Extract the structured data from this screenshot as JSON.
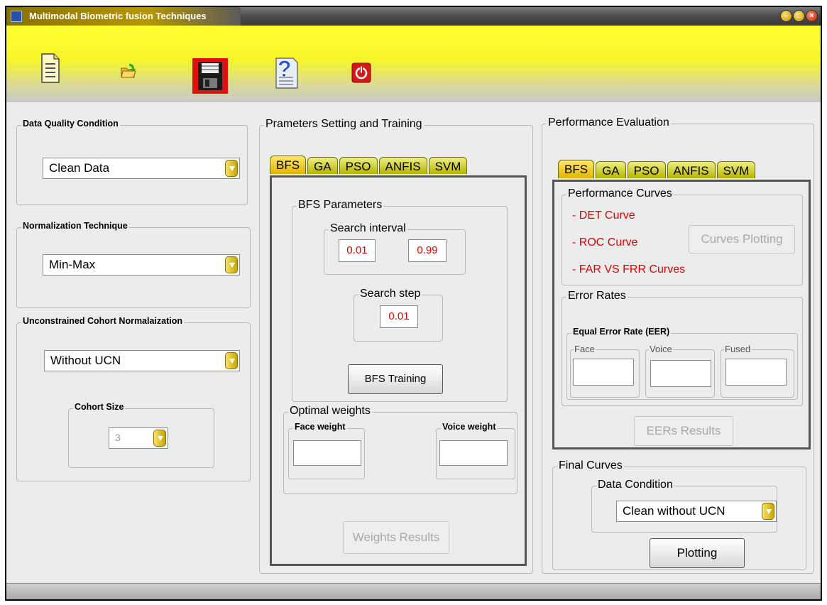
{
  "window": {
    "title": "Multimodal Biometric fusion Techniques"
  },
  "toolbar": {
    "icons": [
      "new-document-icon",
      "open-folder-icon",
      "save-floppy-icon",
      "help-icon",
      "power-exit-icon"
    ]
  },
  "left": {
    "data_quality": {
      "label": "Data Quality Condition",
      "value": "Clean Data"
    },
    "normalization": {
      "label": "Normalization Technique",
      "value": "Min-Max"
    },
    "ucn": {
      "label": "Unconstrained Cohort  Normalaization",
      "value": "Without UCN"
    },
    "cohort": {
      "label": "Cohort Size",
      "value": "3"
    }
  },
  "params": {
    "title": "Prameters Setting and Training",
    "tabs": [
      "BFS",
      "GA",
      "PSO",
      "ANFIS",
      "SVM"
    ],
    "bfs_parameters": "BFS Parameters",
    "search_interval": {
      "label": "Search interval",
      "min": "0.01",
      "max": "0.99"
    },
    "search_step": {
      "label": "Search step",
      "value": "0.01"
    },
    "train_button": "BFS Training",
    "optimal_weights": "Optimal weights",
    "face_weight": "Face weight",
    "voice_weight": "Voice weight",
    "weights_button": "Weights Results"
  },
  "perf": {
    "title": "Performance Evaluation",
    "tabs": [
      "BFS",
      "GA",
      "PSO",
      "ANFIS",
      "SVM"
    ],
    "curves_label": "Performance Curves",
    "curves": [
      "- DET Curve",
      "- ROC Curve",
      "- FAR VS FRR Curves"
    ],
    "curves_button": "Curves Plotting",
    "error_rates": "Error Rates",
    "eer_label": "Equal Error Rate (EER)",
    "eer_face": "Face",
    "eer_voice": "Voice",
    "eer_fused": "Fused",
    "eer_button": "EERs Results",
    "final_curves": "Final Curves",
    "data_condition": "Data Condition",
    "data_condition_value": "Clean without UCN",
    "plot_button": "Plotting"
  }
}
